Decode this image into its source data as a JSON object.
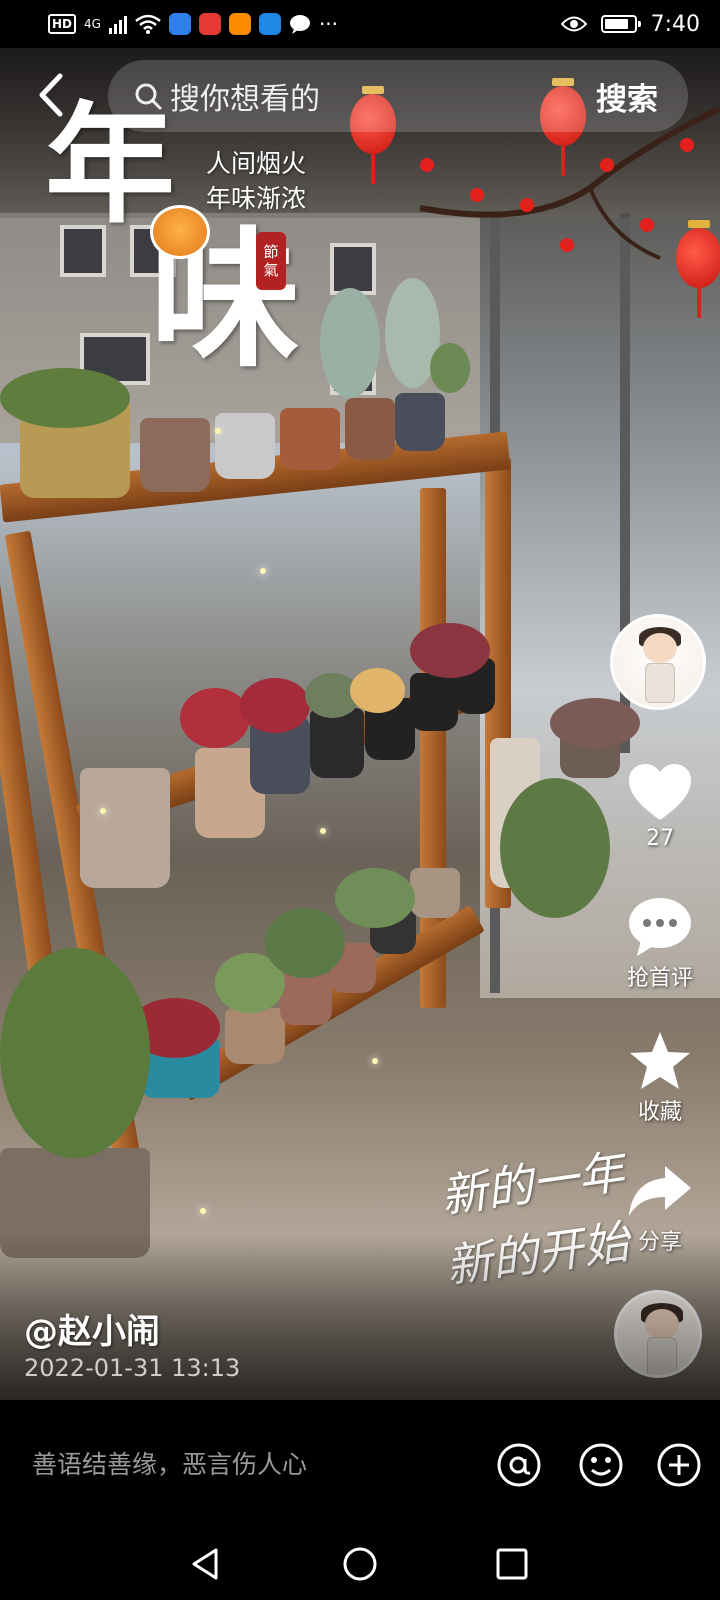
{
  "status_bar": {
    "chip": "HD",
    "network": "4G",
    "time": "7:40",
    "battery_level": 0.85
  },
  "header": {
    "search_placeholder": "搜你想看的",
    "search_button": "搜索"
  },
  "overlay": {
    "big_char_1": "年",
    "big_char_2": "味",
    "slogan_line_1": "人间烟火",
    "slogan_line_2": "年味渐浓",
    "seal_text_1": "節",
    "seal_text_2": "氣",
    "handwriting_line_1": "新的一年",
    "handwriting_line_2": "新的开始"
  },
  "actions": {
    "like_count": "27",
    "comment_label": "抢首评",
    "favorite_label": "收藏",
    "share_label": "分享"
  },
  "post": {
    "author": "@赵小闹",
    "date": "2022-01-31 13:13"
  },
  "comment_bar": {
    "placeholder": "善语结善缘，恶言伤人心"
  },
  "colors": {
    "background": "#000000",
    "lantern_red": "#d8221a",
    "wood": "#b56b2e"
  }
}
